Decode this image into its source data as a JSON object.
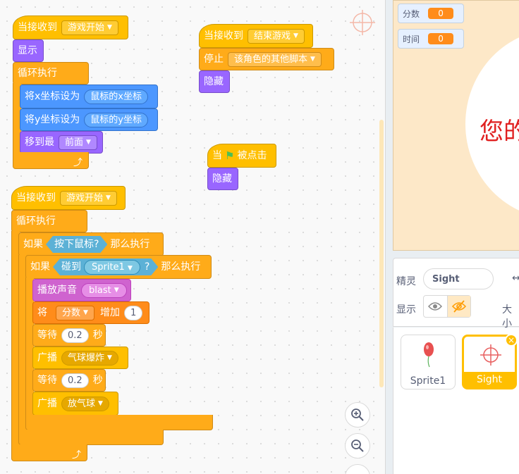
{
  "scripts": {
    "game_start": {
      "hat_label": "当接收到",
      "hat_message": "游戏开始",
      "show": "显示",
      "forever": "循环执行",
      "set_x": "将x坐标设为",
      "set_x_value": "鼠标的x坐标",
      "set_y": "将y坐标设为",
      "set_y_value": "鼠标的y坐标",
      "goto_layer": "移到最",
      "goto_layer_value": "前面"
    },
    "game_end": {
      "hat_label": "当接收到",
      "hat_message": "结束游戏",
      "stop": "停止",
      "stop_option": "该角色的其他脚本",
      "hide": "隐藏"
    },
    "flag": {
      "hat_prefix": "当",
      "hat_suffix": "被点击",
      "hide": "隐藏"
    },
    "mouse_loop": {
      "hat_label": "当接收到",
      "hat_message": "游戏开始",
      "forever": "循环执行",
      "if1": "如果",
      "if1_cond": "按下鼠标?",
      "if1_then": "那么执行",
      "if2": "如果",
      "if2_cond": "碰到",
      "if2_target": "Sprite1",
      "if2_q": "?",
      "if2_then": "那么执行",
      "play_sound": "播放声音",
      "sound_name": "blast",
      "change_var": "将",
      "var_name": "分数",
      "change_by": "增加",
      "change_value": "1",
      "wait1": "等待",
      "wait1_value": "0.2",
      "wait1_unit": "秒",
      "broadcast1": "广播",
      "broadcast1_msg": "气球爆炸",
      "wait2": "等待",
      "wait2_value": "0.2",
      "wait2_unit": "秒",
      "broadcast2": "广播",
      "broadcast2_msg": "放气球"
    }
  },
  "stage": {
    "score_label": "分数",
    "score_value": "0",
    "time_label": "时间",
    "time_value": "0",
    "visible_text": "您的"
  },
  "sprite_info": {
    "sprite_label": "精灵",
    "sprite_name": "Sight",
    "show_label": "显示",
    "size_label": "大小"
  },
  "sprites": [
    {
      "name": "Sprite1"
    },
    {
      "name": "Sight"
    }
  ],
  "colors": {
    "events": "#ffbf00",
    "looks": "#9966ff",
    "control": "#ffab19",
    "motion": "#4c97ff",
    "sound": "#cf63cf",
    "variables": "#ff8c1a",
    "sensing": "#5cb1d6"
  }
}
